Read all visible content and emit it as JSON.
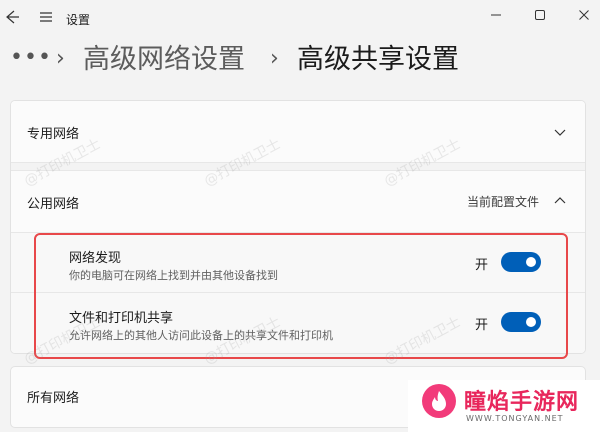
{
  "window": {
    "title": "设置",
    "back_icon": "arrow-left-icon",
    "menu_icon": "hamburger-icon",
    "minimize_icon": "minimize-icon",
    "maximize_icon": "maximize-icon",
    "close_icon": "close-icon"
  },
  "breadcrumb": {
    "more": "•••",
    "items": [
      "高级网络设置",
      "高级共享设置"
    ]
  },
  "sections": {
    "private": {
      "label": "专用网络",
      "expanded": false
    },
    "public": {
      "label": "公用网络",
      "current_profile": "当前配置文件",
      "expanded": true,
      "settings": [
        {
          "title": "网络发现",
          "desc": "你的电脑可在网络上找到并由其他设备找到",
          "state": "开",
          "on": true
        },
        {
          "title": "文件和打印机共享",
          "desc": "允许网络上的其他人访问此设备上的共享文件和打印机",
          "state": "开",
          "on": true
        }
      ]
    },
    "all": {
      "label": "所有网络"
    }
  },
  "colors": {
    "accent": "#005fb8",
    "highlight": "#e8484a",
    "logo": "#e8275c"
  },
  "watermark": {
    "stamp": "@打印机卫士",
    "logo_text": "瞳焰手游网",
    "logo_url": "WWW.TONGYAN.NET"
  }
}
